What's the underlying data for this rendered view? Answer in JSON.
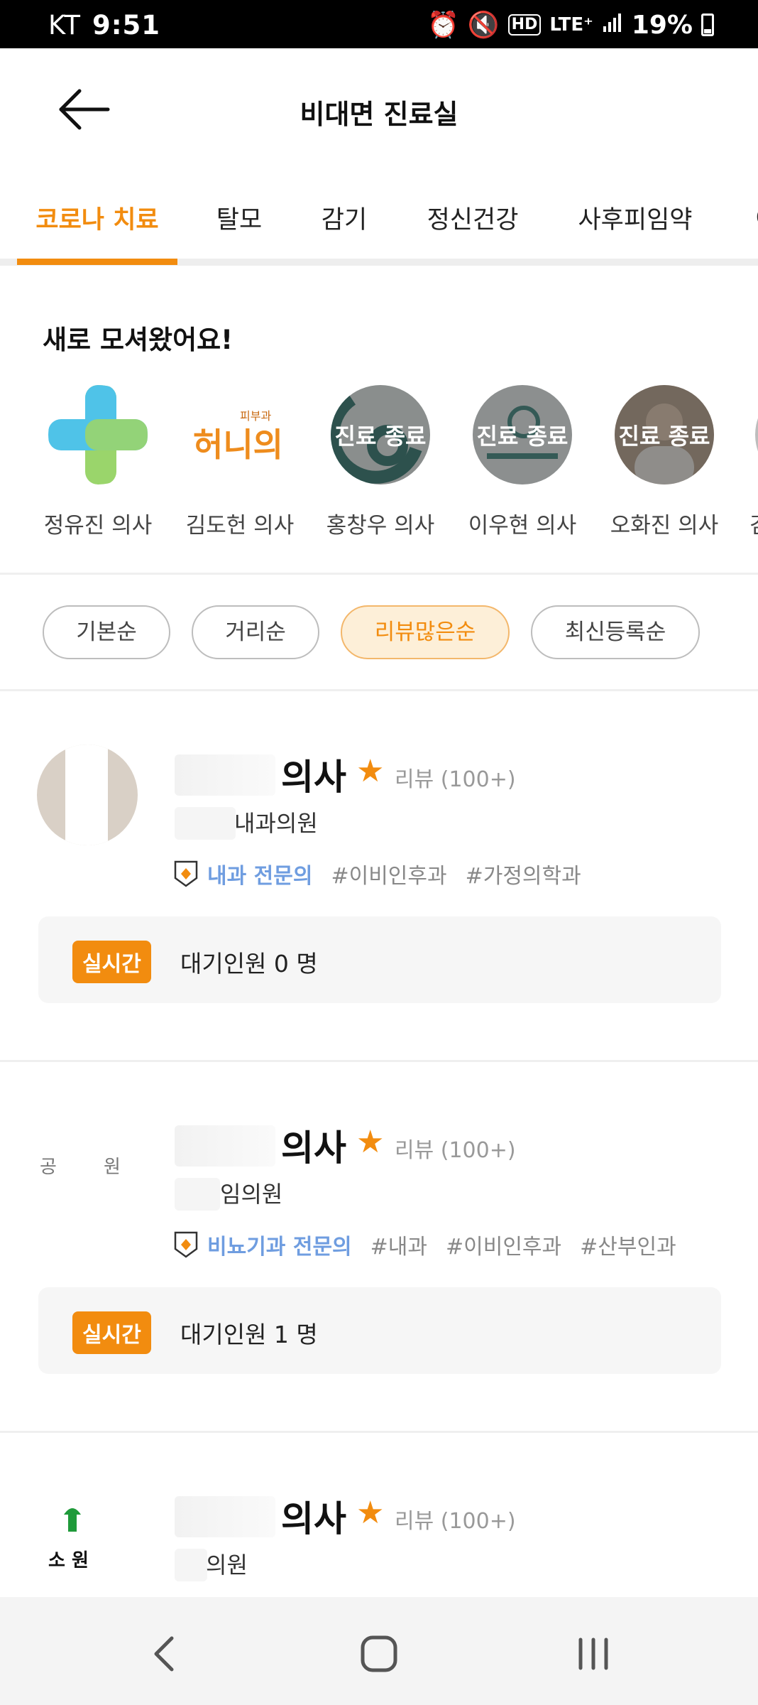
{
  "status_bar": {
    "carrier": "KT",
    "time": "9:51",
    "network": "LTE⁺",
    "hd": "HD",
    "battery": "19%"
  },
  "header": {
    "title": "비대면 진료실"
  },
  "tabs": [
    {
      "label": "코로나 치료",
      "active": true
    },
    {
      "label": "탈모",
      "active": false
    },
    {
      "label": "감기",
      "active": false
    },
    {
      "label": "정신건강",
      "active": false
    },
    {
      "label": "사후피임약",
      "active": false
    }
  ],
  "new_doctors": {
    "title": "새로 모셔왔어요!",
    "items": [
      {
        "name": "정유진 의사",
        "status": ""
      },
      {
        "name": "김도헌 의사",
        "status": "",
        "logo_text": "허니의",
        "logo_sub": "피부과"
      },
      {
        "name": "홍창우 의사",
        "status": "진료 종료"
      },
      {
        "name": "이우현 의사",
        "status": "진료 종료"
      },
      {
        "name": "오화진 의사",
        "status": "진료 종료"
      }
    ]
  },
  "sort_options": [
    {
      "label": "기본순",
      "active": false
    },
    {
      "label": "거리순",
      "active": false
    },
    {
      "label": "리뷰많은순",
      "active": true
    },
    {
      "label": "최신등록순",
      "active": false
    }
  ],
  "doctors": [
    {
      "name_suffix": "의사",
      "review": "리뷰 (100+)",
      "hospital": "내과의원",
      "specialty": "내과 전문의",
      "hashtags": [
        "#이비인후과",
        "#가정의학과"
      ],
      "live_label": "실시간",
      "waiting": "대기인원 0 명"
    },
    {
      "name_suffix": "의사",
      "review": "리뷰 (100+)",
      "hospital": "임의원",
      "specialty": "비뇨기과 전문의",
      "hashtags": [
        "#내과",
        "#이비인후과",
        "#산부인과"
      ],
      "live_label": "실시간",
      "waiting": "대기인원 1 명"
    },
    {
      "name_suffix": "의사",
      "review": "리뷰 (100+)",
      "hospital": "의원",
      "logo_text": "소  원"
    }
  ],
  "colors": {
    "accent": "#f28c0f",
    "accent_light": "#fdefd8",
    "specialty_blue": "#6f9de0"
  }
}
